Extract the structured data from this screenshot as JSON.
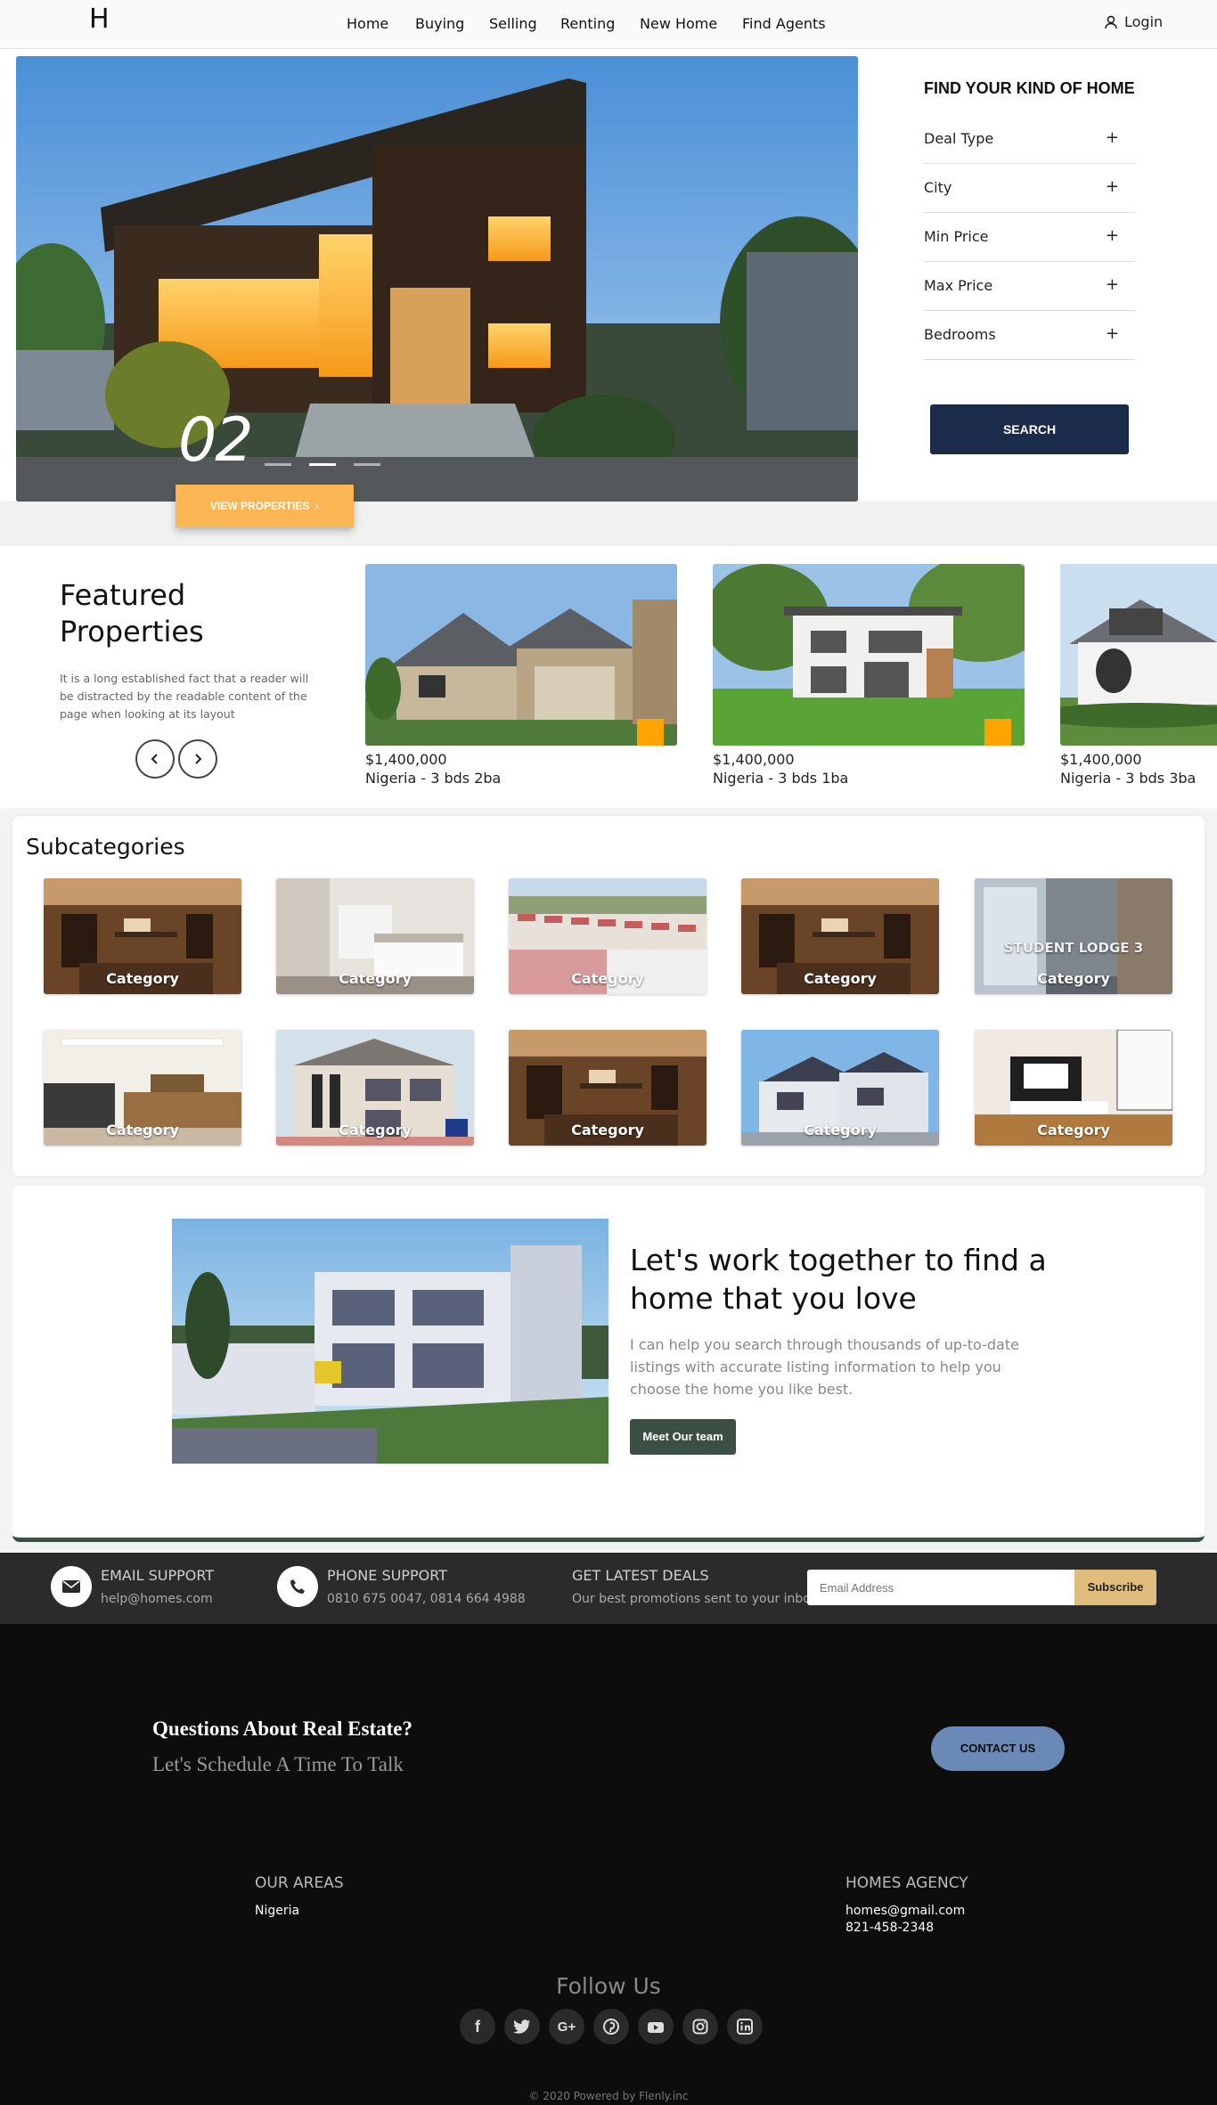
{
  "header": {
    "logo": "H",
    "nav": [
      "Home",
      "Buying",
      "Selling",
      "Renting",
      "New Home",
      "Find Agents"
    ],
    "login": "Login"
  },
  "hero": {
    "slide_number": "02",
    "view_button": "VIEW PROPERTIES"
  },
  "finder": {
    "title": "FIND YOUR KIND OF HOME",
    "filters": [
      "Deal Type",
      "City",
      "Min Price",
      "Max Price",
      "Bedrooms"
    ],
    "plus": "+",
    "search_button": "SEARCH"
  },
  "featured": {
    "title": "Featured Properties",
    "description": "It is a long established fact that a reader will be distracted by the readable content of the page when looking at its layout",
    "cards": [
      {
        "price": "$1,400,000",
        "desc": "Nigeria - 3 bds 2ba"
      },
      {
        "price": "$1,400,000",
        "desc": "Nigeria - 3 bds 1ba"
      },
      {
        "price": "$1,400,000",
        "desc": "Nigeria - 3 bds 3ba"
      }
    ]
  },
  "subcategories": {
    "title": "Subcategories",
    "tile_label": "Category",
    "student_lodge": "STUDENT LODGE 3"
  },
  "promo": {
    "title": "Let's work together to find a home that you love",
    "text": "I can help you search through thousands of up-to-date listings with accurate listing information to help you choose the home you like best.",
    "button": "Meet Our team"
  },
  "support": {
    "email_title": "EMAIL SUPPORT",
    "email_value": "help@homes.com",
    "phone_title": "PHONE SUPPORT",
    "phone_value": "0810 675 0047, 0814 664 4988",
    "deals_title": "GET LATEST DEALS",
    "deals_text": "Our best promotions sent to your inbox.",
    "email_placeholder": "Email Address",
    "subscribe": "Subscribe"
  },
  "footer": {
    "question_title": "Questions About Real Estate?",
    "question_sub": "Let's Schedule A Time To Talk",
    "contact_button": "CONTACT US",
    "areas_title": "OUR AREAS",
    "areas_value": "Nigeria",
    "agency_title": "HOMES AGENCY",
    "agency_email": "homes@gmail.com",
    "agency_phone": "821-458-2348",
    "follow": "Follow Us",
    "socials": [
      "facebook-icon",
      "twitter-icon",
      "google-plus-icon",
      "pinterest-icon",
      "youtube-icon",
      "instagram-icon",
      "linkedin-icon"
    ],
    "copyright": "© 2020 Powered by Flenly.inc"
  },
  "colors": {
    "accent_orange": "#fbb654",
    "navy": "#1b2b4a",
    "green": "#3c4f45",
    "gold": "#e0bd7c",
    "contact_blue": "#6b89b6"
  }
}
